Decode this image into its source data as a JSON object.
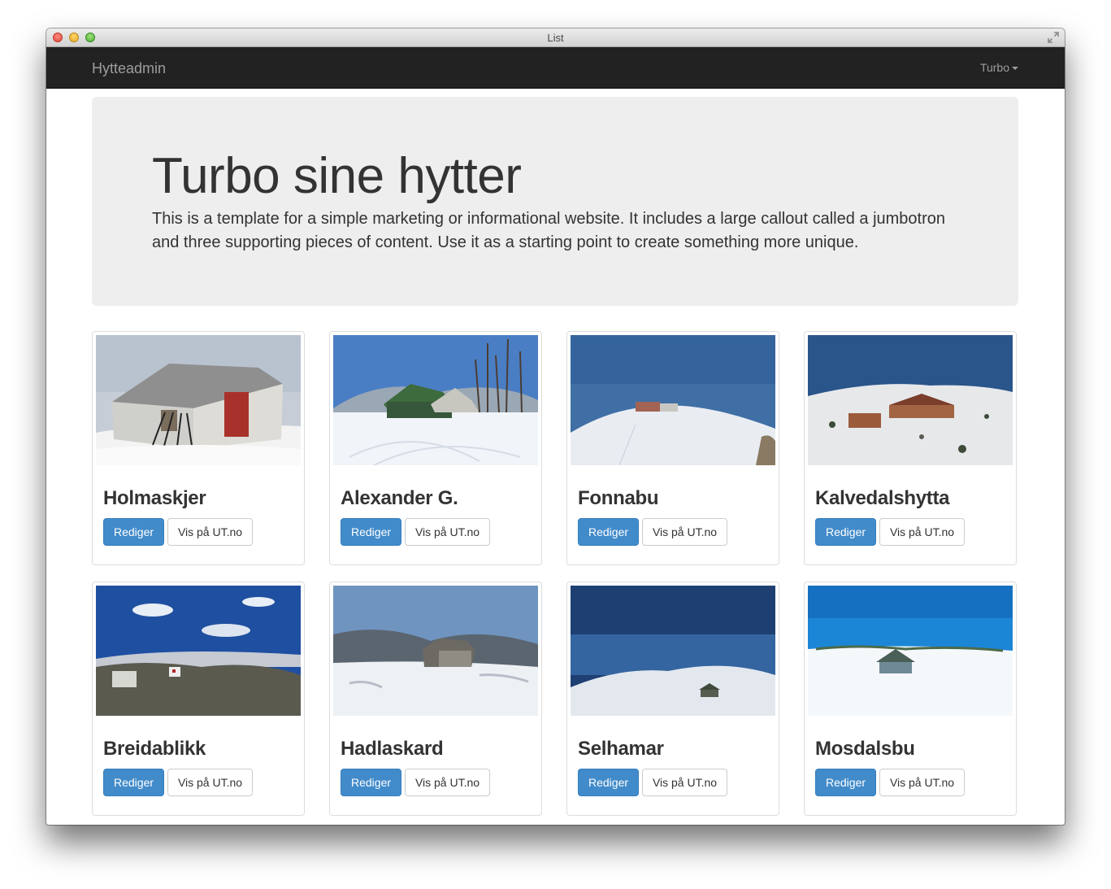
{
  "window": {
    "title": "List"
  },
  "navbar": {
    "brand": "Hytteadmin",
    "user": "Turbo"
  },
  "jumbotron": {
    "heading": "Turbo sine hytter",
    "text": "This is a template for a simple marketing or informational website. It includes a large callout called a jumbotron and three supporting pieces of content. Use it as a starting point to create something more unique."
  },
  "cabins": [
    {
      "name": "Holmaskjer",
      "edit_label": "Rediger",
      "view_label": "Vis på UT.no"
    },
    {
      "name": "Alexander G.",
      "edit_label": "Rediger",
      "view_label": "Vis på UT.no"
    },
    {
      "name": "Fonnabu",
      "edit_label": "Rediger",
      "view_label": "Vis på UT.no"
    },
    {
      "name": "Kalvedalshytta",
      "edit_label": "Rediger",
      "view_label": "Vis på UT.no"
    },
    {
      "name": "Breidablikk",
      "edit_label": "Rediger",
      "view_label": "Vis på UT.no"
    },
    {
      "name": "Hadlaskard",
      "edit_label": "Rediger",
      "view_label": "Vis på UT.no"
    },
    {
      "name": "Selhamar",
      "edit_label": "Rediger",
      "view_label": "Vis på UT.no"
    },
    {
      "name": "Mosdalsbu",
      "edit_label": "Rediger",
      "view_label": "Vis på UT.no"
    }
  ],
  "colors": {
    "primary": "#428bca",
    "navbar_bg": "#222222",
    "jumbotron_bg": "#eeeeee"
  }
}
